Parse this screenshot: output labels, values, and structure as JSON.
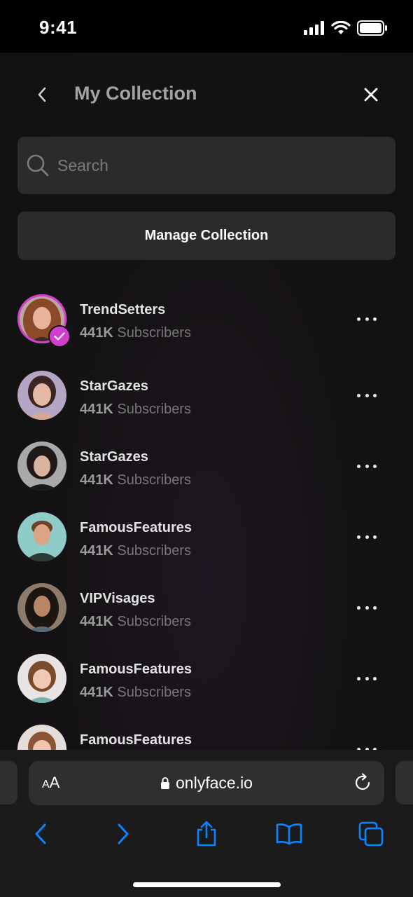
{
  "status_bar": {
    "time": "9:41"
  },
  "header": {
    "title": "My Collection"
  },
  "search": {
    "placeholder": "Search"
  },
  "manage_button": {
    "label": "Manage Collection"
  },
  "collection": [
    {
      "name": "TrendSetters",
      "count": "441K",
      "label": "Subscribers",
      "selected": true
    },
    {
      "name": "StarGazes",
      "count": "441K",
      "label": "Subscribers",
      "selected": false
    },
    {
      "name": "StarGazes",
      "count": "441K",
      "label": "Subscribers",
      "selected": false
    },
    {
      "name": "FamousFeatures",
      "count": "441K",
      "label": "Subscribers",
      "selected": false
    },
    {
      "name": "VIPVisages",
      "count": "441K",
      "label": "Subscribers",
      "selected": false
    },
    {
      "name": "FamousFeatures",
      "count": "441K",
      "label": "Subscribers",
      "selected": false
    },
    {
      "name": "FamousFeatures",
      "count": "",
      "label": "",
      "selected": false
    }
  ],
  "browser": {
    "aa_label_small": "A",
    "aa_label": "A",
    "url": "onlyface.io"
  },
  "icons": {
    "back": "chevron-left-icon",
    "close": "close-icon",
    "search": "search-icon",
    "more": "more-horizontal-icon",
    "check": "checkmark-icon",
    "lock": "lock-icon",
    "reload": "reload-icon",
    "nav_back": "arrow-back-icon",
    "nav_forward": "arrow-forward-icon",
    "share": "share-icon",
    "bookmarks": "book-icon",
    "tabs": "tabs-icon"
  },
  "colors": {
    "accent": "#d13fcc",
    "safari_blue": "#0a84ff",
    "surface": "#2b2b2b",
    "background": "#141214"
  }
}
